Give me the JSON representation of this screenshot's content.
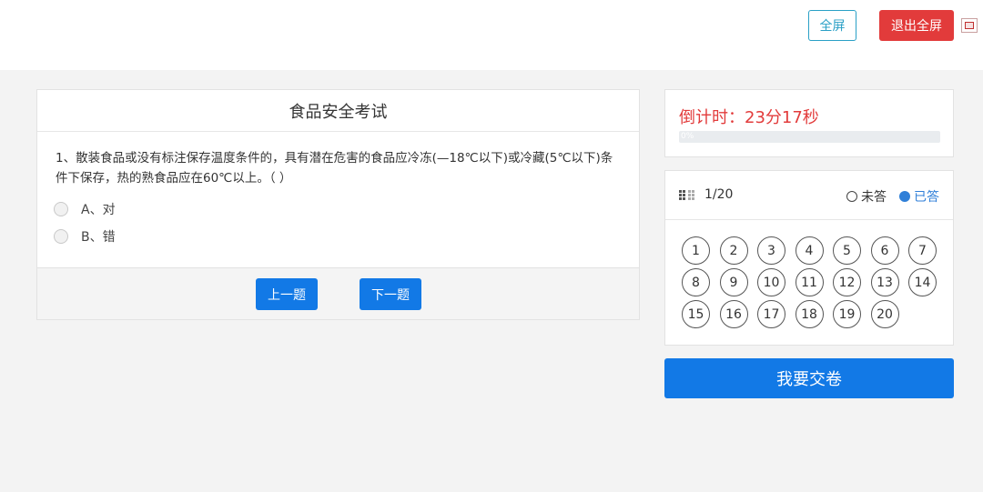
{
  "header": {
    "fullscreen_label": "全屏",
    "exit_fullscreen_label": "退出全屏"
  },
  "exam": {
    "title": "食品安全考试",
    "question": "1、散装食品或没有标注保存温度条件的，具有潜在危害的食品应冷冻(—18℃以下)或冷藏(5℃以下)条件下保存，热的熟食品应在60℃以上。（ ）",
    "options": [
      "A、对",
      "B、错"
    ],
    "prev_label": "上一题",
    "next_label": "下一题"
  },
  "timer": {
    "text": "倒计时：23分17秒",
    "percent_label": "0%",
    "progress_fraction": 0
  },
  "navigator": {
    "progress": "1/20",
    "legend_unanswered": "未答",
    "legend_answered": "已答",
    "numbers": [
      "1",
      "2",
      "3",
      "4",
      "5",
      "6",
      "7",
      "8",
      "9",
      "10",
      "11",
      "12",
      "13",
      "14",
      "15",
      "16",
      "17",
      "18",
      "19",
      "20"
    ]
  },
  "submit_label": "我要交卷",
  "colors": {
    "primary": "#1279e6",
    "danger": "#e23b3b",
    "info": "#2aa0c6",
    "answered": "#2f7fd8"
  }
}
